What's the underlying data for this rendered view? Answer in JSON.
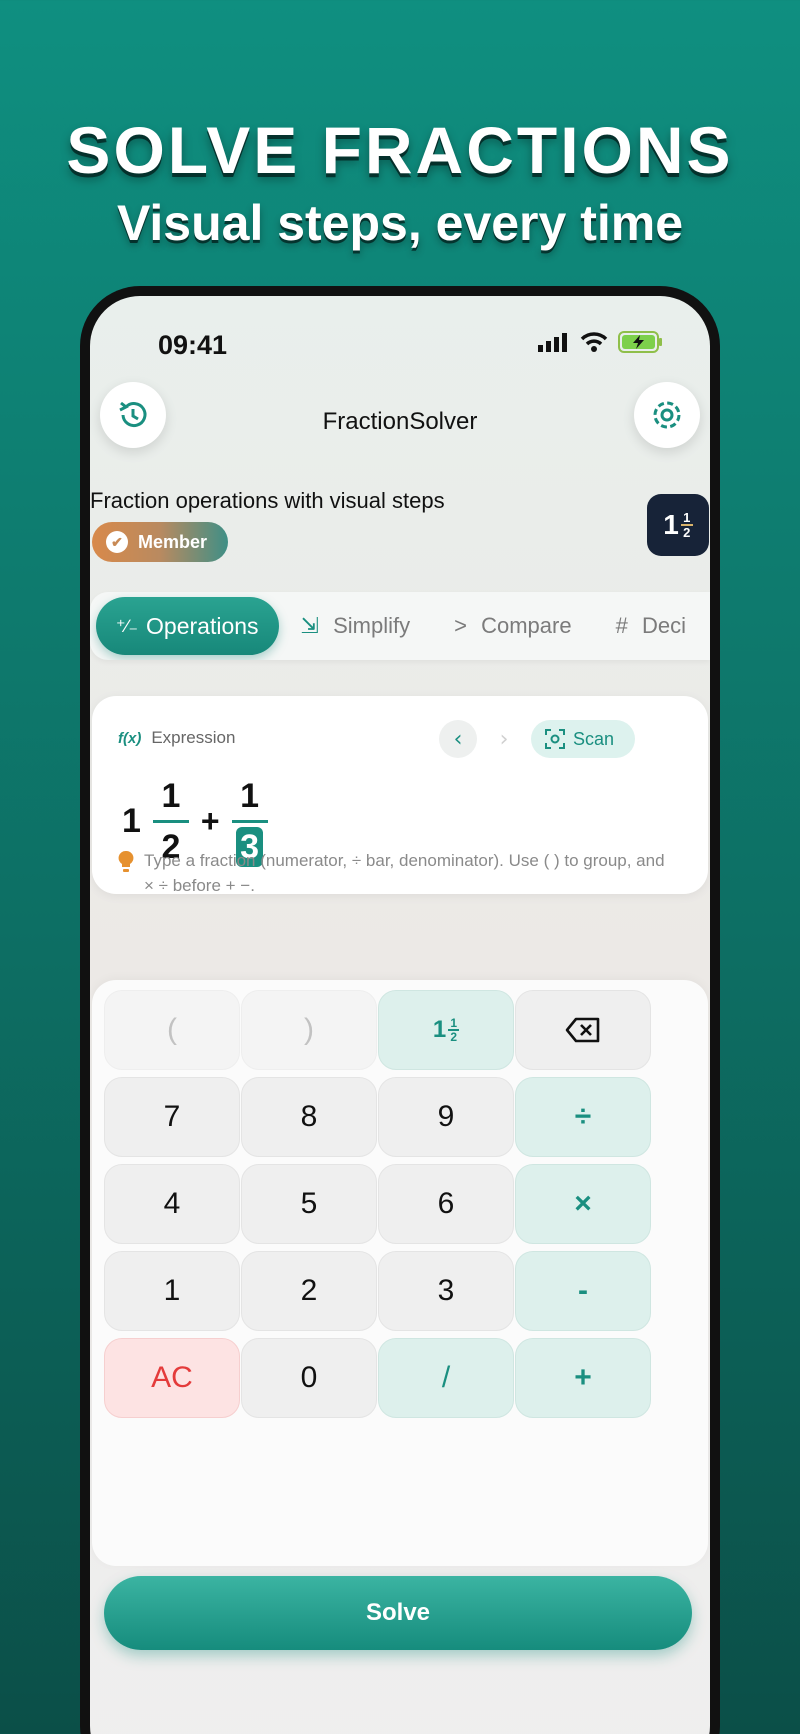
{
  "hero": {
    "title": "SOLVE FRACTIONS",
    "subtitle": "Visual steps, every time"
  },
  "status": {
    "time": "09:41"
  },
  "header": {
    "title": "FractionSolver",
    "subtitle": "Fraction operations with visual steps",
    "badge": "Member"
  },
  "tabs": [
    {
      "icon": "⁺∕₋",
      "label": "Operations"
    },
    {
      "icon": "⇲",
      "label": "Simplify"
    },
    {
      "icon": ">",
      "label": "Compare"
    },
    {
      "icon": "#",
      "label": "Deci"
    }
  ],
  "expression": {
    "label": "Expression",
    "fx": "f(x)",
    "scan_label": "Scan",
    "whole": "1",
    "frac1_num": "1",
    "frac1_den": "2",
    "operator": "+",
    "frac2_num": "1",
    "frac2_den": "3"
  },
  "hint": "Type a fraction (numerator, ÷ bar, denominator). Use ( ) to group, and × ÷ before + −.",
  "keys": {
    "open_paren": "(",
    "close_paren": ")",
    "backspace": "⌫",
    "seven": "7",
    "eight": "8",
    "nine": "9",
    "divide": "÷",
    "four": "4",
    "five": "5",
    "six": "6",
    "multiply": "×",
    "one": "1",
    "two": "2",
    "three": "3",
    "minus": "-",
    "ac": "AC",
    "zero": "0",
    "slash": "/",
    "plus": "+"
  },
  "solve_label": "Solve",
  "colors": {
    "accent": "#1a8f80",
    "background": "#0f8f80",
    "danger": "#e43b3b"
  }
}
